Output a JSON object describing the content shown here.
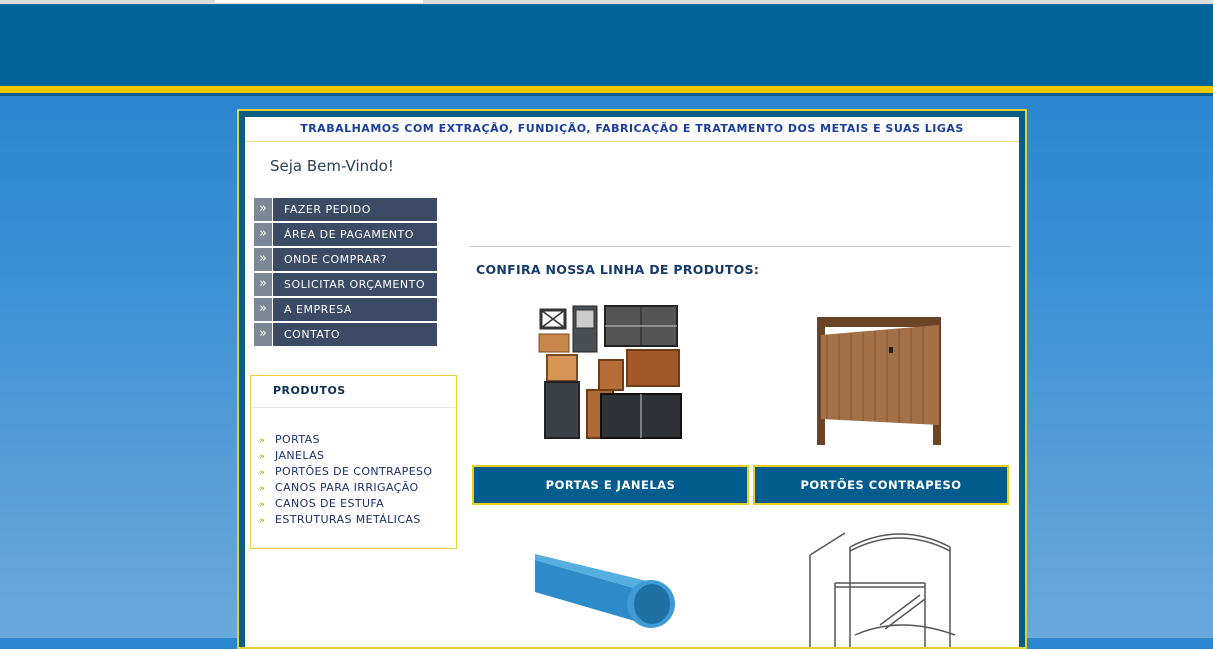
{
  "tagline": "TRABALHAMOS COM EXTRAÇÃO, FUNDIÇÃO, FABRICAÇÃO E TRATAMENTO DOS METAIS E SUAS LIGAS",
  "welcome": "Seja Bem-Vindo!",
  "menu": {
    "arrow": "»",
    "items": [
      "FAZER PEDIDO",
      "ÁREA DE PAGAMENTO",
      "ONDE COMPRAR?",
      "SOLICITAR ORÇAMENTO",
      "A EMPRESA",
      "CONTATO"
    ]
  },
  "produtos": {
    "title": "PRODUTOS",
    "items": [
      "PORTAS",
      "JANELAS",
      "PORTÕES DE CONTRAPESO",
      "CANOS PARA IRRIGAÇÃO",
      "CANOS DE ESTUFA",
      "ESTRUTURAS METÁLICAS"
    ]
  },
  "section_title": "CONFIRA NOSSA LINHA DE PRODUTOS:",
  "categories": [
    "PORTAS E JANELAS",
    "PORTÕES CONTRAPESO"
  ],
  "colors": {
    "header": "#00659a",
    "accent_yellow": "#f7c800",
    "menu_bg": "#3b4b66",
    "button_bg": "#035c8e"
  }
}
